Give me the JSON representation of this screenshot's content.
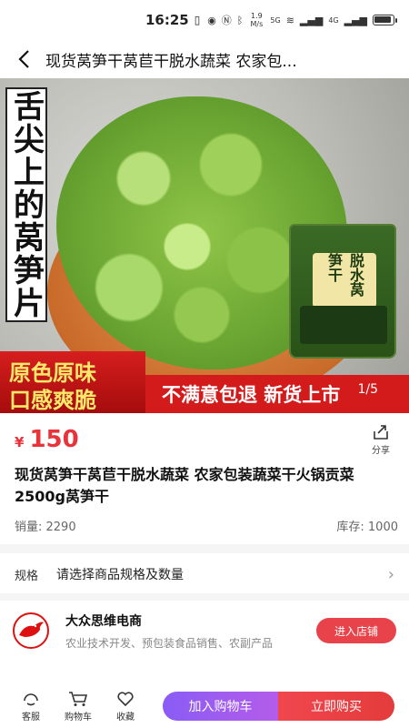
{
  "status_bar": {
    "time": "16:25",
    "net_speed": "1.9 M/s",
    "signal_1": "5G",
    "signal_2": "4G",
    "battery_level": 0.9
  },
  "nav": {
    "title": "现货莴笋干莴苣干脱水蔬菜 农家包..."
  },
  "hero": {
    "vertical_text": "舌尖上的莴笋片",
    "package_label": "脱水莴笋干",
    "banner_line1": "原色原味",
    "banner_line2": "口感爽脆",
    "banner_strip": "不满意包退 新货上市",
    "page_indicator": "1/5"
  },
  "price": {
    "symbol": "¥",
    "value": "150"
  },
  "share_label": "分享",
  "product": {
    "title": "现货莴笋干莴苣干脱水蔬菜 农家包装蔬菜干火锅贡菜 2500g莴笋干"
  },
  "stats": {
    "sales": "销量: 2290",
    "stock": "库存: 1000"
  },
  "spec": {
    "key": "规格",
    "value": "请选择商品规格及数量"
  },
  "shop": {
    "name": "大众思维电商",
    "desc": "农业技术开发、预包装食品销售、农副产品",
    "enter_label": "进入店铺"
  },
  "bottom_bar": {
    "service_label": "客服",
    "cart_label": "购物车",
    "favorite_label": "收藏",
    "add_cart_label": "加入购物车",
    "buy_now_label": "立即购买"
  },
  "colors": {
    "price_red": "#e8333a",
    "cart_purple": "#8a5cf5",
    "buy_red": "#f0464e"
  }
}
